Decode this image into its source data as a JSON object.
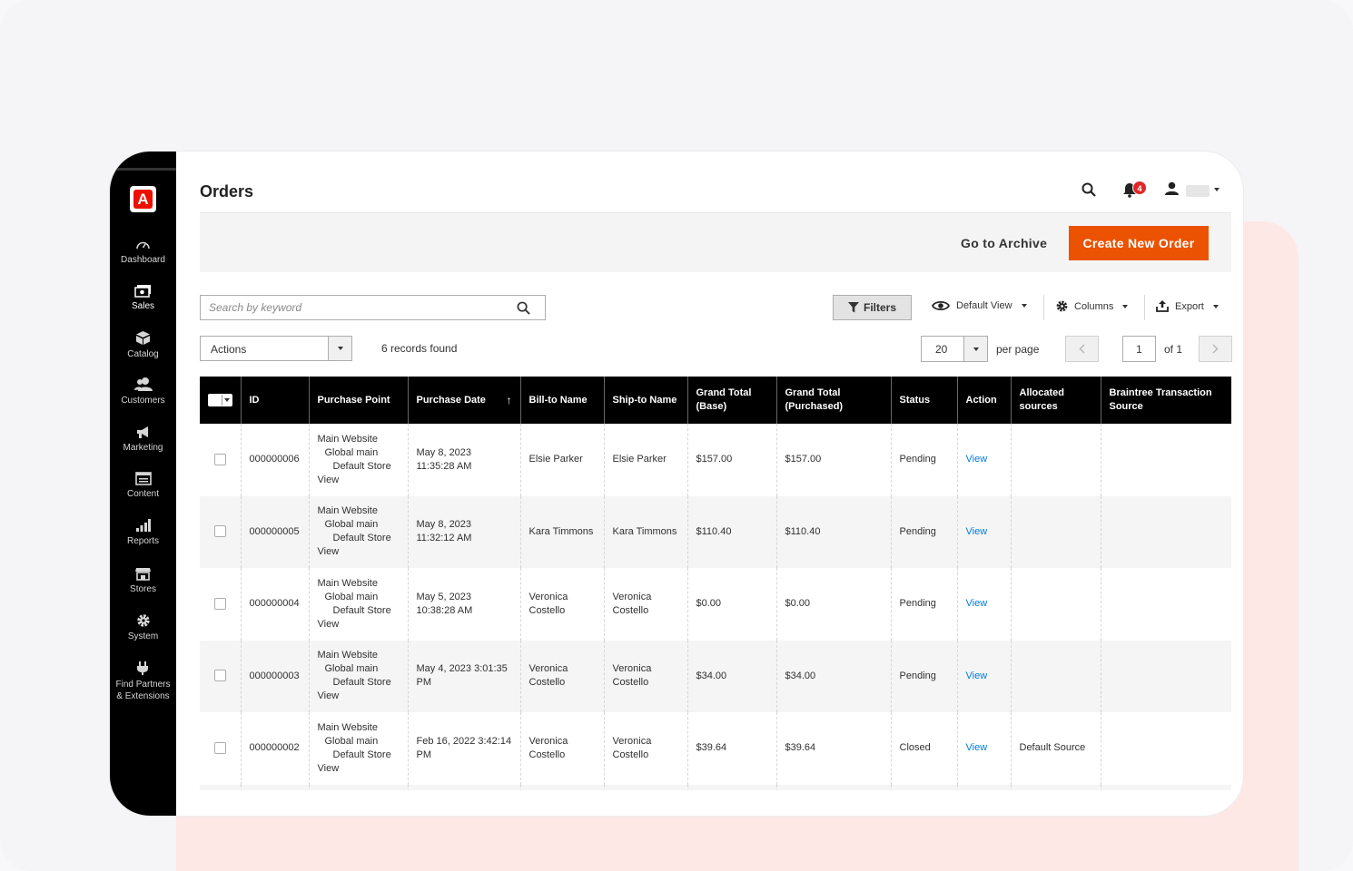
{
  "sidebar": {
    "logo_letter": "A",
    "items": [
      {
        "label": "Dashboard",
        "icon": "dashboard-icon"
      },
      {
        "label": "Sales",
        "icon": "sales-icon"
      },
      {
        "label": "Catalog",
        "icon": "catalog-icon"
      },
      {
        "label": "Customers",
        "icon": "customers-icon"
      },
      {
        "label": "Marketing",
        "icon": "marketing-icon"
      },
      {
        "label": "Content",
        "icon": "content-icon"
      },
      {
        "label": "Reports",
        "icon": "reports-icon"
      },
      {
        "label": "Stores",
        "icon": "stores-icon"
      },
      {
        "label": "System",
        "icon": "system-icon"
      },
      {
        "label": "Find Partners & Extensions",
        "icon": "partners-icon"
      }
    ]
  },
  "header": {
    "title": "Orders",
    "notification_count": "4"
  },
  "actionbar": {
    "archive_label": "Go to Archive",
    "create_label": "Create New Order"
  },
  "toolbar": {
    "search_placeholder": "Search by keyword",
    "filters_label": "Filters",
    "view_label": "Default View",
    "columns_label": "Columns",
    "export_label": "Export",
    "actions_label": "Actions",
    "records_found": "6 records found",
    "per_page_value": "20",
    "per_page_label": "per page",
    "page_value": "1",
    "page_of": "of 1"
  },
  "grid": {
    "columns": [
      "ID",
      "Purchase Point",
      "Purchase Date",
      "Bill-to Name",
      "Ship-to Name",
      "Grand Total (Base)",
      "Grand Total (Purchased)",
      "Status",
      "Action",
      "Allocated sources",
      "Braintree Transaction Source"
    ],
    "sort_indicator": "↑",
    "rows": [
      {
        "id": "000000006",
        "pp1": "Main Website",
        "pp2": "Global main",
        "pp3": "Default Store",
        "pp4": "View",
        "date": "May 8, 2023 11:35:28 AM",
        "bill": "Elsie Parker",
        "ship": "Elsie Parker",
        "base": "$157.00",
        "purchased": "$157.00",
        "status": "Pending",
        "action": "View",
        "sources": "",
        "braintree": ""
      },
      {
        "id": "000000005",
        "pp1": "Main Website",
        "pp2": "Global main",
        "pp3": "Default Store",
        "pp4": "View",
        "date": "May 8, 2023 11:32:12 AM",
        "bill": "Kara Timmons",
        "ship": "Kara Timmons",
        "base": "$110.40",
        "purchased": "$110.40",
        "status": "Pending",
        "action": "View",
        "sources": "",
        "braintree": ""
      },
      {
        "id": "000000004",
        "pp1": "Main Website",
        "pp2": "Global main",
        "pp3": "Default Store",
        "pp4": "View",
        "date": "May 5, 2023 10:38:28 AM",
        "bill": "Veronica Costello",
        "ship": "Veronica Costello",
        "base": "$0.00",
        "purchased": "$0.00",
        "status": "Pending",
        "action": "View",
        "sources": "",
        "braintree": ""
      },
      {
        "id": "000000003",
        "pp1": "Main Website",
        "pp2": "Global main",
        "pp3": "Default Store",
        "pp4": "View",
        "date": "May 4, 2023 3:01:35 PM",
        "bill": "Veronica Costello",
        "ship": "Veronica Costello",
        "base": "$34.00",
        "purchased": "$34.00",
        "status": "Pending",
        "action": "View",
        "sources": "",
        "braintree": ""
      },
      {
        "id": "000000002",
        "pp1": "Main Website",
        "pp2": "Global main",
        "pp3": "Default Store",
        "pp4": "View",
        "date": "Feb 16, 2022 3:42:14 PM",
        "bill": "Veronica Costello",
        "ship": "Veronica Costello",
        "base": "$39.64",
        "purchased": "$39.64",
        "status": "Closed",
        "action": "View",
        "sources": "Default Source",
        "braintree": ""
      }
    ]
  },
  "colors": {
    "accent": "#eb5202",
    "brand": "#eb1000",
    "link": "#007bdb",
    "sidebar": "#000000",
    "badge": "#e22626"
  }
}
